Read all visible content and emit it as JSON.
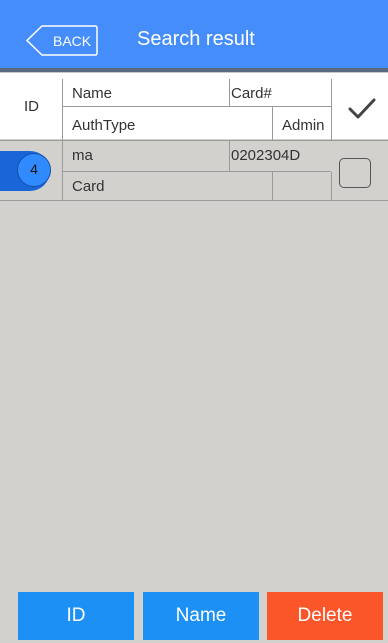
{
  "topbar": {
    "back_label": "BACK",
    "title": "Search result"
  },
  "table": {
    "header": {
      "id": "ID",
      "name": "Name",
      "card": "Card#",
      "authtype": "AuthType",
      "admin": "Admin",
      "select_all_icon": "checkmark-icon"
    },
    "rows": [
      {
        "id": "4",
        "name": "ma",
        "card": "0202304D",
        "authtype": "Card",
        "admin": "",
        "checked": false
      }
    ]
  },
  "buttons": {
    "id": "ID",
    "name": "Name",
    "delete": "Delete"
  },
  "colors": {
    "primary": "#448dfa",
    "button_blue": "#1c90f5",
    "delete_red": "#fa5629",
    "background": "#d3d1cd"
  }
}
